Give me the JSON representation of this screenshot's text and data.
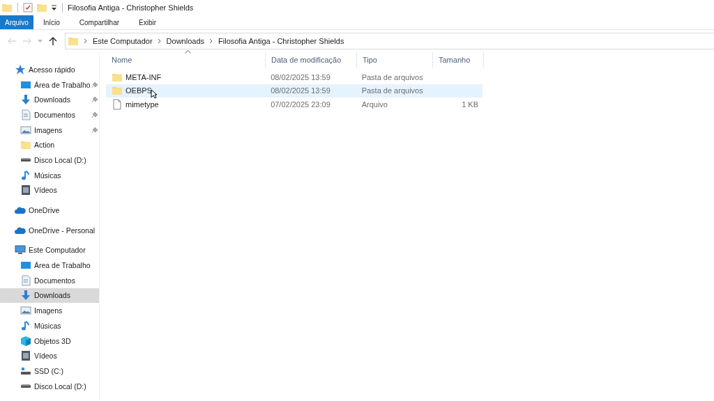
{
  "window": {
    "title": "Filosofia Antiga - Christopher Shields"
  },
  "ribbon_tabs": [
    {
      "label": "Arquivo",
      "kind": "file",
      "selected": false
    },
    {
      "label": "Início",
      "kind": "tab",
      "selected": false
    },
    {
      "label": "Compartilhar",
      "kind": "tab",
      "selected": false
    },
    {
      "label": "Exibir",
      "kind": "tab",
      "selected": false
    }
  ],
  "navigation": {
    "back_disabled": true,
    "forward_disabled": true
  },
  "address_bar": {
    "path": [
      "Este Computador",
      "Downloads",
      "Filosofia Antiga - Christopher Shields"
    ]
  },
  "sidebar": {
    "items": [
      {
        "label": "Acesso rápido",
        "kind": "star",
        "selected": false,
        "children": [
          {
            "label": "Área de Trabalho",
            "kind": "desktop",
            "pinned": true,
            "selected": false
          },
          {
            "label": "Downloads",
            "kind": "download",
            "pinned": true,
            "selected": false
          },
          {
            "label": "Documentos",
            "kind": "document",
            "pinned": true,
            "selected": false
          },
          {
            "label": "Imagens",
            "kind": "image",
            "pinned": true,
            "selected": false
          },
          {
            "label": "Action",
            "kind": "folder",
            "pinned": false,
            "selected": false
          },
          {
            "label": "Disco Local (D:)",
            "kind": "drive",
            "pinned": false,
            "selected": false
          },
          {
            "label": "Músicas",
            "kind": "music",
            "pinned": false,
            "selected": false
          },
          {
            "label": "Vídeos",
            "kind": "video",
            "pinned": false,
            "selected": false
          }
        ]
      },
      {
        "label": "OneDrive",
        "kind": "cloud",
        "selected": false
      },
      {
        "label": "OneDrive - Personal",
        "kind": "cloud",
        "selected": false
      },
      {
        "label": "Este Computador",
        "kind": "computer",
        "selected": false,
        "children": [
          {
            "label": "Área de Trabalho",
            "kind": "desktop",
            "pinned": false,
            "selected": false
          },
          {
            "label": "Documentos",
            "kind": "document",
            "pinned": false,
            "selected": false
          },
          {
            "label": "Downloads",
            "kind": "download",
            "pinned": false,
            "selected": true
          },
          {
            "label": "Imagens",
            "kind": "image",
            "pinned": false,
            "selected": false
          },
          {
            "label": "Músicas",
            "kind": "music",
            "pinned": false,
            "selected": false
          },
          {
            "label": "Objetos 3D",
            "kind": "cube",
            "pinned": false,
            "selected": false
          },
          {
            "label": "Vídeos",
            "kind": "video",
            "pinned": false,
            "selected": false
          },
          {
            "label": "SSD (C:)",
            "kind": "system-drive",
            "pinned": false,
            "selected": false
          },
          {
            "label": "Disco Local (D:)",
            "kind": "drive",
            "pinned": false,
            "selected": false
          }
        ]
      }
    ]
  },
  "file_list": {
    "columns": [
      {
        "label": "Nome",
        "sorted": true
      },
      {
        "label": "Data de modificação",
        "sorted": false
      },
      {
        "label": "Tipo",
        "sorted": false
      },
      {
        "label": "Tamanho",
        "sorted": false
      }
    ],
    "rows": [
      {
        "name": "META-INF",
        "kind": "folder",
        "modified": "08/02/2025 13:59",
        "type": "Pasta de arquivos",
        "selected": false
      },
      {
        "name": "OEBPS",
        "kind": "folder",
        "modified": "08/02/2025 13:59",
        "type": "Pasta de arquivos",
        "selected": true
      },
      {
        "name": "mimetype",
        "kind": "file",
        "modified": "07/02/2025 23:09",
        "type": "Arquivo",
        "size": "1 KB",
        "selected": false
      }
    ]
  }
}
